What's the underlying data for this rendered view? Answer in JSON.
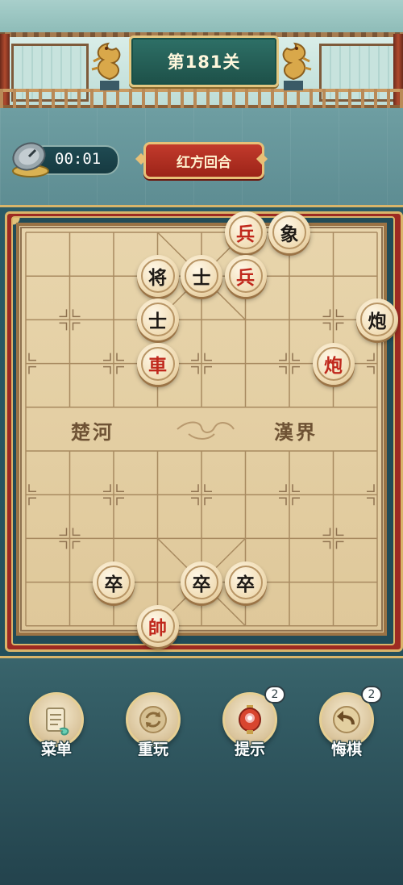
{
  "header": {
    "level_title": "第181关"
  },
  "status": {
    "timer": "00:01",
    "turn": "红方回合"
  },
  "board": {
    "river_left": "楚河",
    "river_right": "漢界",
    "pieces": [
      {
        "char": "兵",
        "side": "red",
        "file": 5,
        "rank": 0
      },
      {
        "char": "象",
        "side": "black",
        "file": 6,
        "rank": 0
      },
      {
        "char": "将",
        "side": "black",
        "file": 3,
        "rank": 1
      },
      {
        "char": "士",
        "side": "black",
        "file": 4,
        "rank": 1
      },
      {
        "char": "兵",
        "side": "red",
        "file": 5,
        "rank": 1
      },
      {
        "char": "炮",
        "side": "black",
        "file": 8,
        "rank": 2
      },
      {
        "char": "士",
        "side": "black",
        "file": 3,
        "rank": 2
      },
      {
        "char": "車",
        "side": "red",
        "file": 3,
        "rank": 3
      },
      {
        "char": "炮",
        "side": "red",
        "file": 7,
        "rank": 3
      },
      {
        "char": "卒",
        "side": "black",
        "file": 2,
        "rank": 8
      },
      {
        "char": "卒",
        "side": "black",
        "file": 4,
        "rank": 8
      },
      {
        "char": "卒",
        "side": "black",
        "file": 5,
        "rank": 8
      },
      {
        "char": "帥",
        "side": "red",
        "file": 3,
        "rank": 9
      }
    ]
  },
  "actions": [
    {
      "id": "menu",
      "label": "菜单",
      "icon": "scroll-icon",
      "count": null
    },
    {
      "id": "replay",
      "label": "重玩",
      "icon": "replay-icon",
      "count": null
    },
    {
      "id": "hint",
      "label": "提示",
      "icon": "lantern-icon",
      "count": "2"
    },
    {
      "id": "undo",
      "label": "悔棋",
      "icon": "undo-arrow-icon",
      "count": "2"
    }
  ],
  "colors": {
    "red_piece": "#c0281c",
    "black_piece": "#1e1a16",
    "turn_badge": "#c23a2c",
    "board": "#e8d5ac"
  }
}
